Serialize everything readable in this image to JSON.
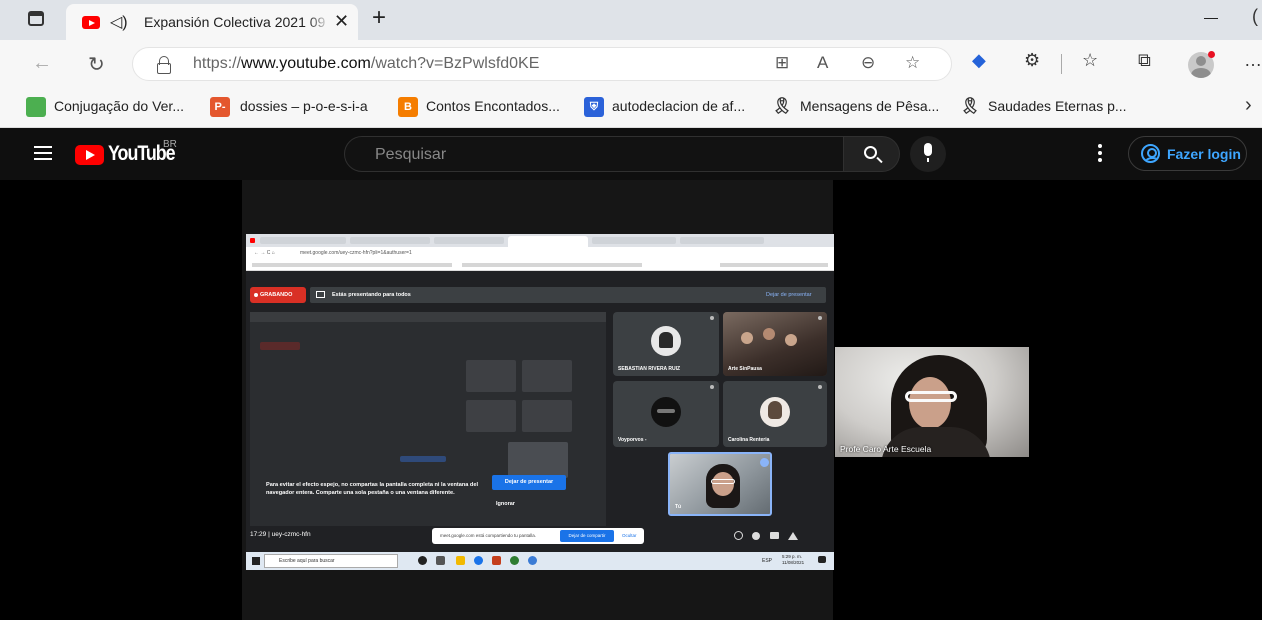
{
  "browser": {
    "tab": {
      "title": "Expansión Colectiva 2021 09"
    },
    "url": {
      "prefix": "https://",
      "host": "www.youtube.com",
      "path": "/watch?v=BzPwlsfd0KE"
    },
    "bookmarks": [
      {
        "label": "Conjugação do Ver...",
        "icon": "green-square-icon",
        "color": "#4caf50"
      },
      {
        "label": "dossies – p-o-e-s-i-a",
        "icon": "P-icon",
        "color": "#e4572e"
      },
      {
        "label": "Contos Encontados...",
        "icon": "blogger-icon",
        "color": "#f57d00"
      },
      {
        "label": "autodeclacion de af...",
        "icon": "shield-icon",
        "color": "#2b62d9"
      },
      {
        "label": "Mensagens de Pêsa...",
        "icon": "ribbon-icon"
      },
      {
        "label": "Saudades Eternas p...",
        "icon": "ribbon-icon"
      }
    ]
  },
  "youtube": {
    "logo_text": "YouTube",
    "region": "BR",
    "search_placeholder": "Pesquisar",
    "login_label": "Fazer login",
    "colors": {
      "brand": "#ff0000",
      "accent": "#3ea6ff",
      "background": "#0f0f0f"
    }
  },
  "video": {
    "meet": {
      "url": "meet.google.com/uey-czmc-hfn?pli=1&authuser=1",
      "recording_label": "GRABANDO",
      "presenting_text": "Estás presentando para todos",
      "stop_presenting_link": "Dejar de presentar",
      "participants": [
        {
          "name": "SEBASTIAN RIVERA RUIZ"
        },
        {
          "name": "Arte SinPausa"
        },
        {
          "name": "Voyporvos -"
        },
        {
          "name": "Carolina Renteria"
        },
        {
          "name": "Tú"
        }
      ],
      "mirror_warning": "Para evitar el efecto espejo, no compartas la pantalla completa ni la ventana del navegador entera. Comparte una sola pestaña o una ventana diferente.",
      "stop_button": "Dejar de presentar",
      "ignore_label": "Ignorar",
      "time": "17:29",
      "meeting_code": "uey-czmc-hfn",
      "sharing_notice": "meet.google.com está compartiendo tu pantalla.",
      "sharing_stop": "Dejar de compartir",
      "sharing_hide": "Ocultar",
      "taskbar_search": "Escribe aquí para buscar",
      "clock_time": "5:29 p. m.",
      "clock_date": "11/08/2021",
      "taskbar_lang": "ESP"
    },
    "camera_label": "Profe Caro Arte Escuela"
  }
}
